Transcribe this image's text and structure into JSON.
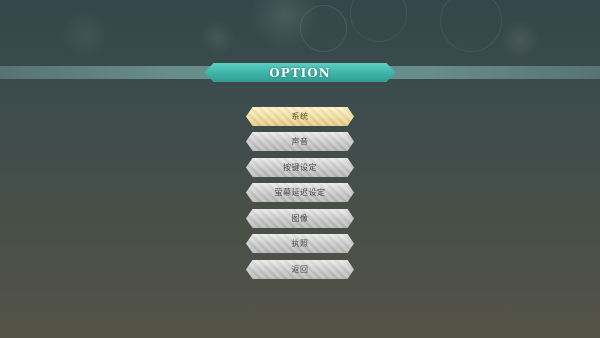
{
  "screen": {
    "title": "OPTION"
  },
  "menu": {
    "selected_index": 0,
    "items": [
      {
        "label": "系统"
      },
      {
        "label": "声音"
      },
      {
        "label": "按键设定"
      },
      {
        "label": "萤幕延迟设定"
      },
      {
        "label": "图像"
      },
      {
        "label": "执照"
      },
      {
        "label": "返回"
      }
    ]
  },
  "colors": {
    "banner": "#3fb3a8",
    "selected_item": "#f0dc9c",
    "item": "#c9c9c9",
    "background": "#3e4c4c"
  }
}
